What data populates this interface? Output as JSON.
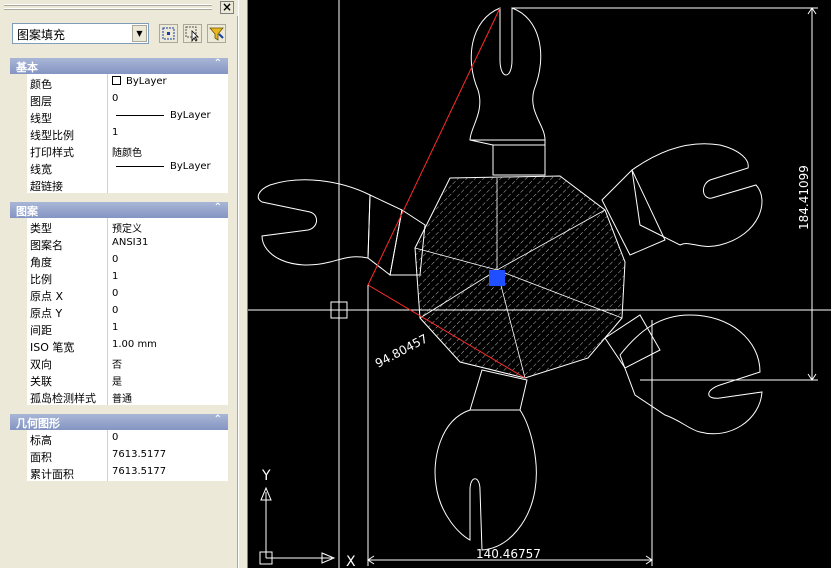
{
  "object_selector": {
    "value": "图案填充"
  },
  "sections": {
    "basic": {
      "title": "基本",
      "rows": [
        {
          "name": "颜色",
          "value": "ByLayer"
        },
        {
          "name": "图层",
          "value": "0"
        },
        {
          "name": "线型",
          "value": "ByLayer"
        },
        {
          "name": "线型比例",
          "value": "1"
        },
        {
          "name": "打印样式",
          "value": "随颜色"
        },
        {
          "name": "线宽",
          "value": "ByLayer"
        },
        {
          "name": "超链接",
          "value": ""
        }
      ]
    },
    "pattern": {
      "title": "图案",
      "rows": [
        {
          "name": "类型",
          "value": "预定义"
        },
        {
          "name": "图案名",
          "value": "ANSI31"
        },
        {
          "name": "角度",
          "value": "0"
        },
        {
          "name": "比例",
          "value": "1"
        },
        {
          "name": "原点 X",
          "value": "0"
        },
        {
          "name": "原点 Y",
          "value": "0"
        },
        {
          "name": "间距",
          "value": "1"
        },
        {
          "name": "ISO 笔宽",
          "value": "1.00 mm"
        },
        {
          "name": "双向",
          "value": "否"
        },
        {
          "name": "关联",
          "value": "是"
        },
        {
          "name": "孤岛检测样式",
          "value": "普通"
        }
      ]
    },
    "geometry": {
      "title": "几何图形",
      "rows": [
        {
          "name": "标高",
          "value": "0"
        },
        {
          "name": "面积",
          "value": "7613.5177"
        },
        {
          "name": "累计面积",
          "value": "7613.5177"
        }
      ]
    }
  },
  "drawing": {
    "dim_vertical": "184.41099",
    "dim_horizontal": "140.46757",
    "dim_aligned": "94.80457",
    "ucs_x_label": "X",
    "ucs_y_label": "Y",
    "grip_color": "#1f4fff",
    "dim_line_color": "#ff2a2a"
  }
}
